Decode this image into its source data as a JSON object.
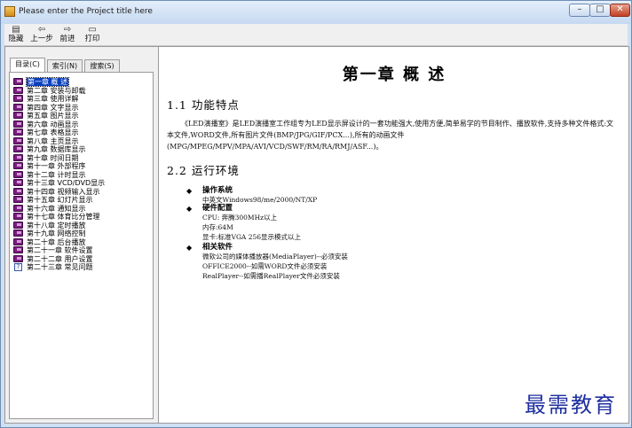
{
  "window": {
    "title": "Please enter the Project title here",
    "min_glyph": "–",
    "max_glyph": "□",
    "close_glyph": "✕"
  },
  "toolbar": {
    "hide": {
      "label": "隐藏",
      "icon": "hide-icon",
      "glyph": "▤"
    },
    "back": {
      "label": "上一步",
      "icon": "arrow-left-icon",
      "glyph": "⇦"
    },
    "forward": {
      "label": "前进",
      "icon": "arrow-right-icon",
      "glyph": "⇨"
    },
    "print": {
      "label": "打印",
      "icon": "printer-icon",
      "glyph": "▭"
    }
  },
  "tabs": [
    {
      "label": "目录(C)",
      "active": true
    },
    {
      "label": "索引(N)",
      "active": false
    },
    {
      "label": "搜索(S)",
      "active": false
    }
  ],
  "toc": [
    {
      "label": "第一章 概 述",
      "icon": "book-icon",
      "selected": true
    },
    {
      "label": "第二章 安装与卸载",
      "icon": "book-icon"
    },
    {
      "label": "第三章 使用详解",
      "icon": "book-icon"
    },
    {
      "label": "第四章 文字显示",
      "icon": "book-icon"
    },
    {
      "label": "第五章 图片显示",
      "icon": "book-icon"
    },
    {
      "label": "第六章 动画显示",
      "icon": "book-icon"
    },
    {
      "label": "第七章 表格显示",
      "icon": "book-icon"
    },
    {
      "label": "第八章 主页显示",
      "icon": "book-icon"
    },
    {
      "label": "第九章 数据库显示",
      "icon": "book-icon"
    },
    {
      "label": "第十章 时间日期",
      "icon": "book-icon"
    },
    {
      "label": "第十一章 外部程序",
      "icon": "book-icon"
    },
    {
      "label": "第十二章 计时显示",
      "icon": "book-icon"
    },
    {
      "label": "第十三章 VCD/DVD显示",
      "icon": "book-icon"
    },
    {
      "label": "第十四章 视频输入显示",
      "icon": "book-icon"
    },
    {
      "label": "第十五章 幻灯片显示",
      "icon": "book-icon"
    },
    {
      "label": "第十六章 通知显示",
      "icon": "book-icon"
    },
    {
      "label": "第十七章 体育比分管理",
      "icon": "book-icon"
    },
    {
      "label": "第十八章 定时播放",
      "icon": "book-icon"
    },
    {
      "label": "第十九章 网络控制",
      "icon": "book-icon"
    },
    {
      "label": "第二十章 后台播放",
      "icon": "book-icon"
    },
    {
      "label": "第二十一章 软件设置",
      "icon": "book-icon"
    },
    {
      "label": "第二十二章 用户设置",
      "icon": "book-icon"
    },
    {
      "label": "第二十三章 常见问题",
      "icon": "question-page-icon"
    }
  ],
  "content": {
    "chapter_title": "第一章 概 述",
    "section1_title": "1.1 功能特点",
    "section1_text": "《LED演播室》是LED演播室工作组专为LED显示屏设计的一套功能强大,使用方便,简单易学的节目制作、播放软件,支持多种文件格式:文本文件,WORD文件,所有图片文件(BMP/JPG/GIF/PCX...),所有的动画文件(MPG/MPEG/MPV/MPA/AVI/VCD/SWF/RM/RA/RMJ/ASF...)。",
    "section2_title": "2.2 运行环境",
    "bullets": [
      {
        "title": "操作系统",
        "lines": [
          "中英文Windows98/me/2000/NT/XP"
        ]
      },
      {
        "title": "硬件配置",
        "lines": [
          "CPU: 奔腾300MHz以上",
          "内存:64M",
          "显卡:标准VGA 256显示模式以上"
        ]
      },
      {
        "title": "相关软件",
        "lines": [
          "微软公司的媒体播放器(MediaPlayer)--必须安装",
          "OFFICE2000--如需WORD文件必须安装",
          "RealPlayer--如需播RealPlayer文件必须安装"
        ]
      }
    ]
  },
  "watermark": "最需教育",
  "colors": {
    "selection": "#0a3fbf",
    "book": "#7a1c80",
    "watermark": "#1f2fa0"
  }
}
